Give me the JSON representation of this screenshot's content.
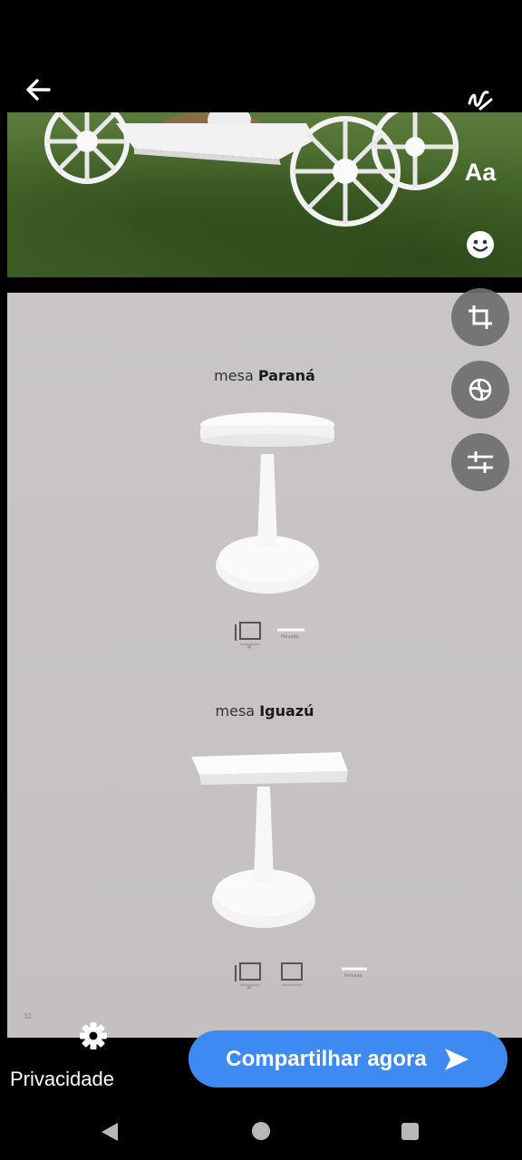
{
  "header": {
    "back_icon": "arrow-left-icon",
    "draw_icon": "squiggle-draw-icon"
  },
  "tools": {
    "text_label": "Aa",
    "sticker_icon": "smiley-icon",
    "crop_icon": "crop-icon",
    "filter_icon": "filter-icon",
    "adjust_icon": "sliders-icon"
  },
  "catalog": {
    "product1": {
      "prefix": "mesa",
      "name": "Paraná",
      "dim_label": "M",
      "extra_label": "Pelxada"
    },
    "product2": {
      "prefix": "mesa",
      "name": "Iguazú",
      "dim_label": "M",
      "extra_label": "Pelxada"
    },
    "page_number": "32"
  },
  "footer": {
    "privacy_label": "Privacidade",
    "privacy_icon": "gear-icon",
    "share_label": "Compartilhar agora",
    "share_icon": "send-arrow-icon"
  },
  "navbar": {
    "back_icon": "triangle-back-icon",
    "home_icon": "circle-home-icon",
    "recents_icon": "square-recents-icon"
  },
  "colors": {
    "accent": "#3d8bf2",
    "tool_bg": "#6e6e6e",
    "catalog_bg": "#c8c5c4"
  }
}
